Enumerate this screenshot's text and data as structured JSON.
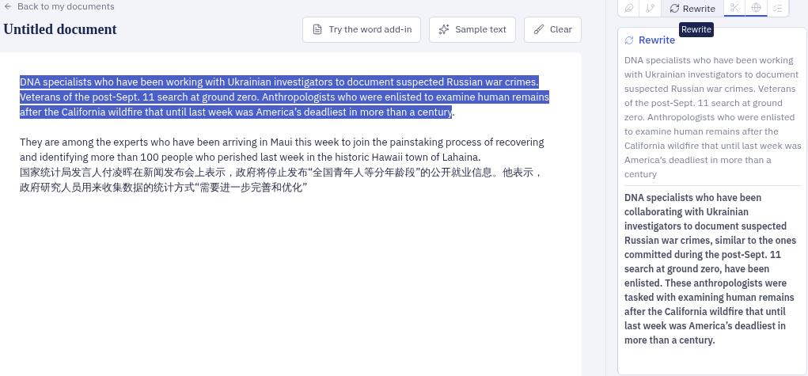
{
  "back_link": "Back to my documents",
  "title": "Untitled document",
  "toolbar": [
    {
      "label": "Try the word add-in",
      "kind": "word"
    },
    {
      "label": "Sample text",
      "kind": "sparkle"
    },
    {
      "label": "Clear",
      "kind": "broom"
    }
  ],
  "document": {
    "highlighted_text": "DNA specialists who have been working with Ukrainian investigators to document suspected Russian war crimes. Veterans of the post-Sept. 11 search at ground zero. Anthropologists who were enlisted to examine human remains after the California wildfire that until last week was America’s deadliest in more than a century",
    "after_highlight": ".",
    "paragraphs": [
      "They are among the experts who have been arriving in Maui this week to join the painstaking process of recovering and identifying more than 100 people who perished last week in the historic Hawaii town of Lahaina.",
      "国家统计局发言人付凌晖在新闻发布会上表示，政府将停止发布“全国青年人等分年龄段”的公开就业信息。他表示，政府研究人员用来收集数据的统计方式“需要进一步完善和优化”"
    ]
  },
  "tools": [
    {
      "kind": "feather",
      "selected": false,
      "underlined": false
    },
    {
      "kind": "branch",
      "selected": false,
      "underlined": false
    },
    {
      "kind": "rewrite",
      "label": "Rewrite",
      "selected": true,
      "underlined": false
    },
    {
      "kind": "scissors",
      "selected": false,
      "underlined": true
    },
    {
      "kind": "globe",
      "selected": false,
      "underlined": true
    },
    {
      "kind": "list",
      "selected": false,
      "underlined": false
    }
  ],
  "tooltip": "Rewrite",
  "panel": {
    "title": "Rewrite",
    "original": "DNA specialists who have been working with Ukrainian investigators to document suspected Russian war crimes. Veterans of the post-Sept. 11 search at ground zero. Anthropologists who were enlisted to examine human remains after the California wildfire that until last week was America’s deadliest in more than a century",
    "suggestion": "DNA specialists who have been collaborating with Ukrainian investigators to document suspected Russian war crimes, similar to the ones committed during the post-Sept. 11 search at ground zero, have been enlisted. These anthropologists were tasked with examining human remains after the California wildfire that until last week was America’s deadliest in more than a century."
  }
}
